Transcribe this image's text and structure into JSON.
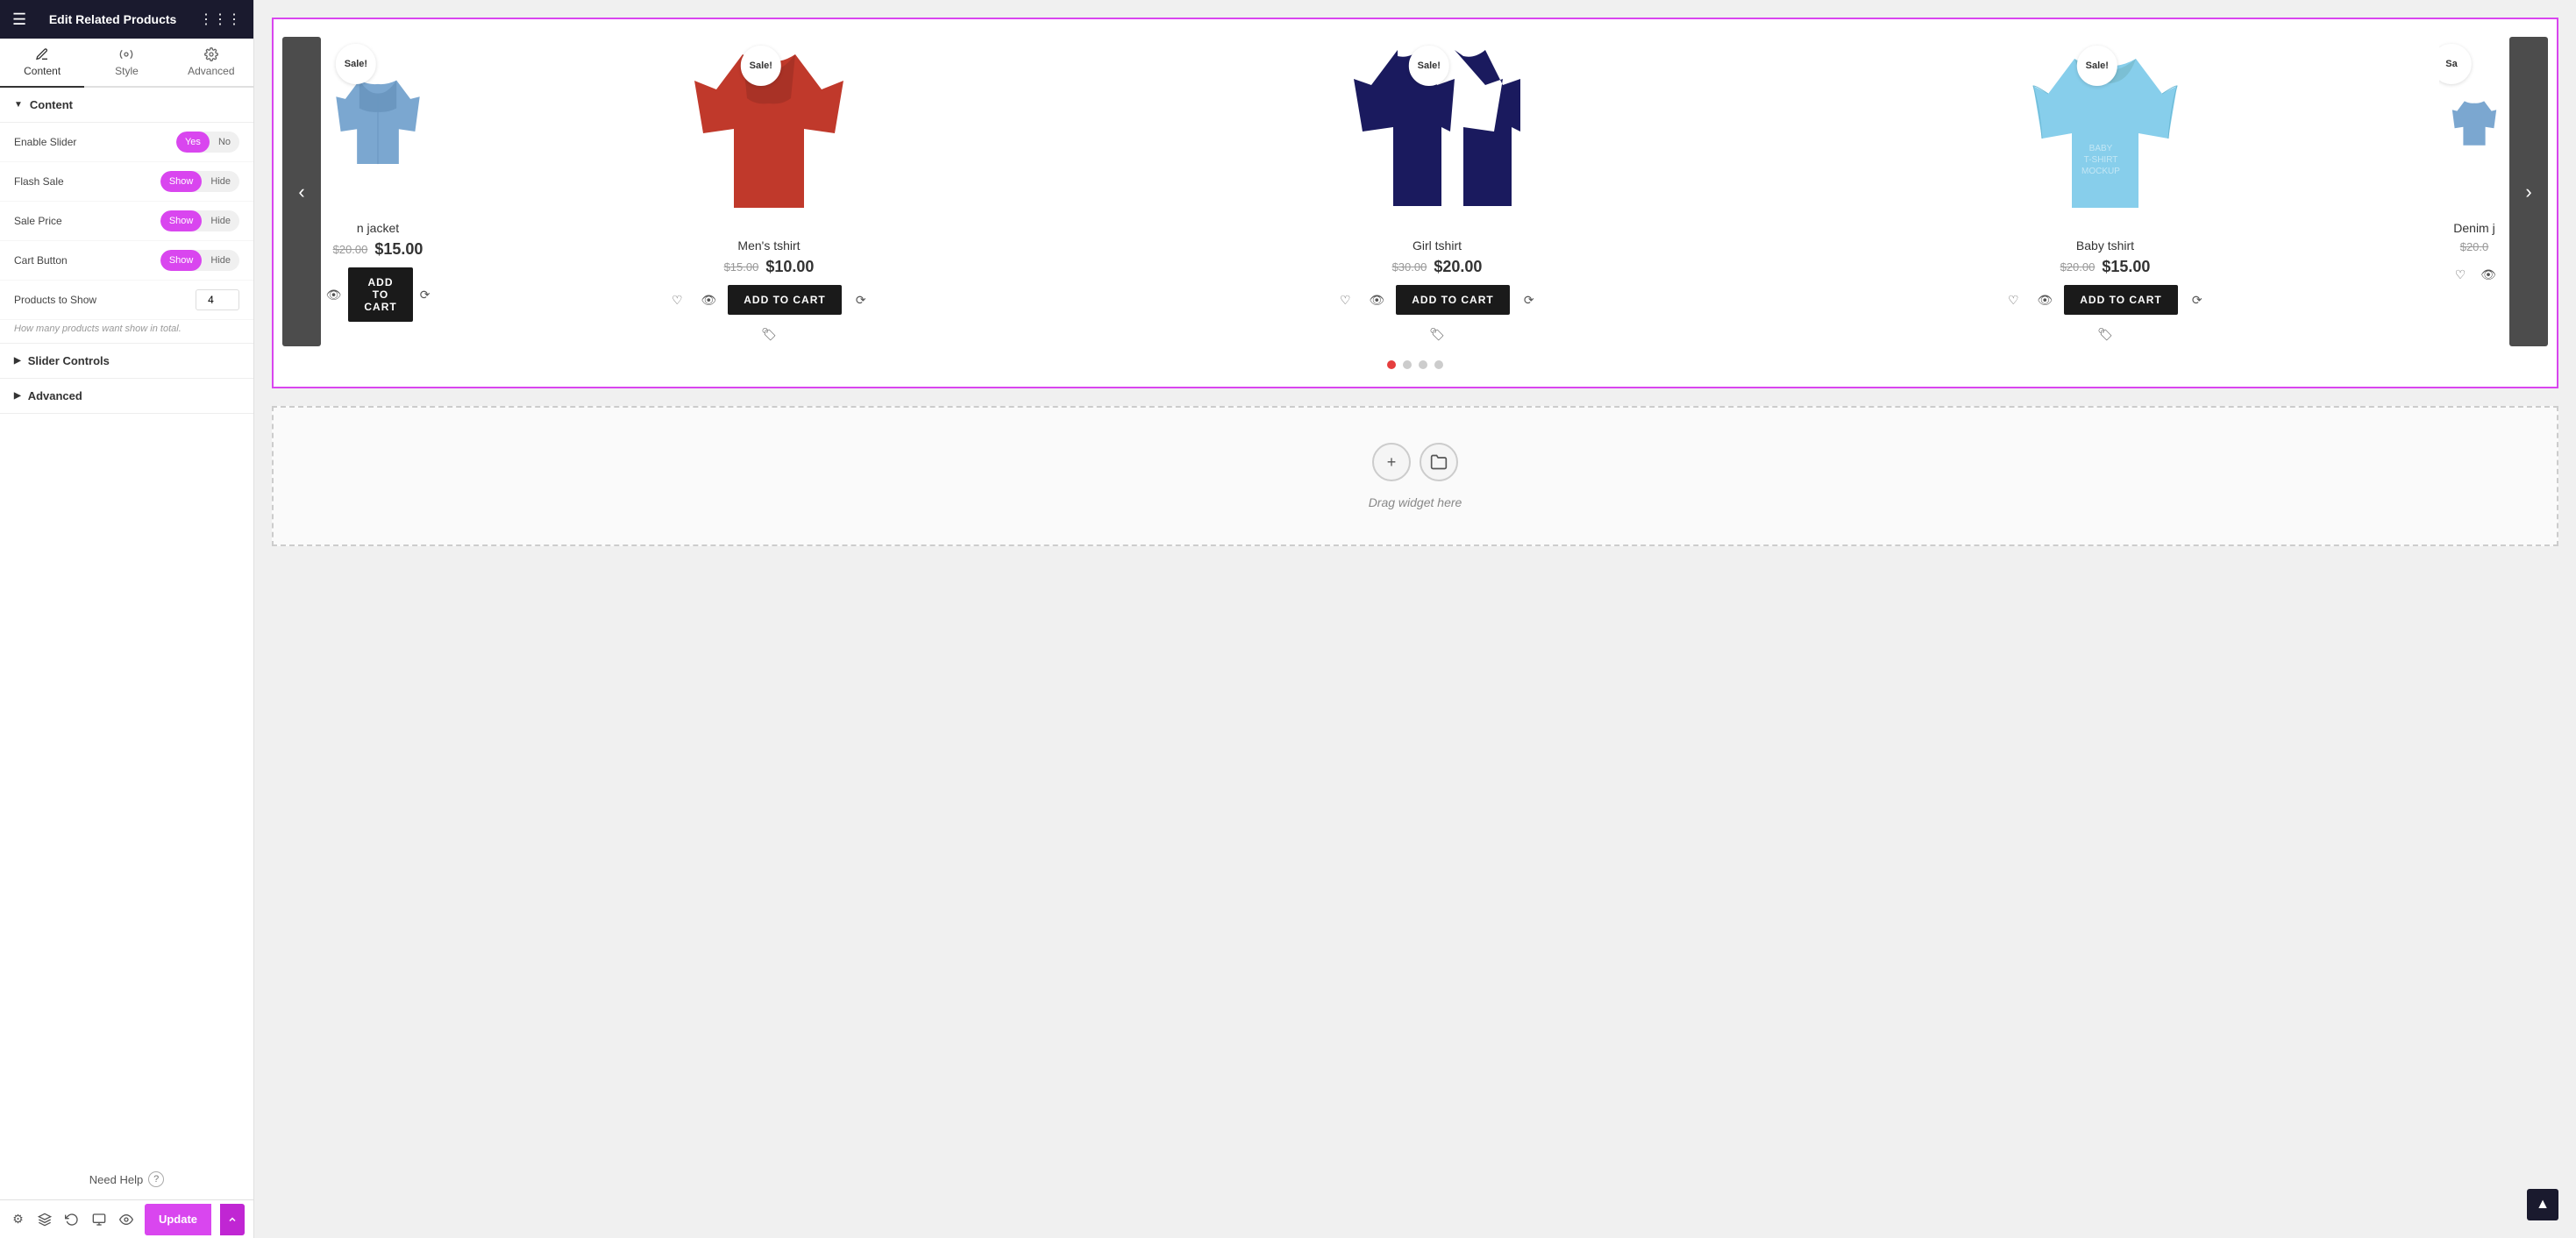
{
  "app": {
    "title": "Edit Related Products"
  },
  "sidebar": {
    "tabs": [
      {
        "id": "content",
        "label": "Content",
        "active": true
      },
      {
        "id": "style",
        "label": "Style",
        "active": false
      },
      {
        "id": "advanced",
        "label": "Advanced",
        "active": false
      }
    ],
    "sections": {
      "content": {
        "label": "Content",
        "expanded": true,
        "controls": [
          {
            "id": "enable-slider",
            "label": "Enable Slider",
            "type": "toggle",
            "value": "Yes",
            "options": [
              "Yes",
              "No"
            ]
          },
          {
            "id": "flash-sale",
            "label": "Flash Sale",
            "type": "toggle",
            "value": "Show",
            "options": [
              "Show",
              "Hide"
            ]
          },
          {
            "id": "sale-price",
            "label": "Sale Price",
            "type": "toggle",
            "value": "Show",
            "options": [
              "Show",
              "Hide"
            ]
          },
          {
            "id": "cart-button",
            "label": "Cart Button",
            "type": "toggle",
            "value": "Show",
            "options": [
              "Show",
              "Hide"
            ]
          }
        ],
        "productsToShow": {
          "label": "Products to Show",
          "value": "4",
          "hint": "How many products want show in total."
        }
      },
      "sliderControls": {
        "label": "Slider Controls",
        "expanded": false
      },
      "advanced": {
        "label": "Advanced",
        "expanded": false
      }
    },
    "needHelp": "Need Help",
    "updateBtn": "Update"
  },
  "products": [
    {
      "id": "partial-left",
      "name": "n jacket",
      "originalPrice": "$20.00",
      "salePrice": "$15.00",
      "sale": true,
      "color": "denim",
      "partial": "left"
    },
    {
      "id": "mens-tshirt",
      "name": "Men's tshirt",
      "originalPrice": "$15.00",
      "salePrice": "$10.00",
      "sale": true,
      "color": "red"
    },
    {
      "id": "girl-tshirt",
      "name": "Girl tshirt",
      "originalPrice": "$30.00",
      "salePrice": "$20.00",
      "sale": true,
      "color": "navy"
    },
    {
      "id": "baby-tshirt",
      "name": "Baby tshirt",
      "originalPrice": "$20.00",
      "salePrice": "$15.00",
      "sale": true,
      "color": "lightblue"
    },
    {
      "id": "denim-partial",
      "name": "Denim j",
      "originalPrice": "$20.0",
      "salePrice": "",
      "sale": true,
      "color": "denim",
      "partial": "right"
    }
  ],
  "slider": {
    "prevLabel": "‹",
    "nextLabel": "›",
    "dots": [
      true,
      false,
      false,
      false
    ],
    "addToCartLabel": "ADD TO CART"
  },
  "dropZone": {
    "text": "Drag widget here"
  },
  "bottomBar": {
    "updateLabel": "Update"
  }
}
